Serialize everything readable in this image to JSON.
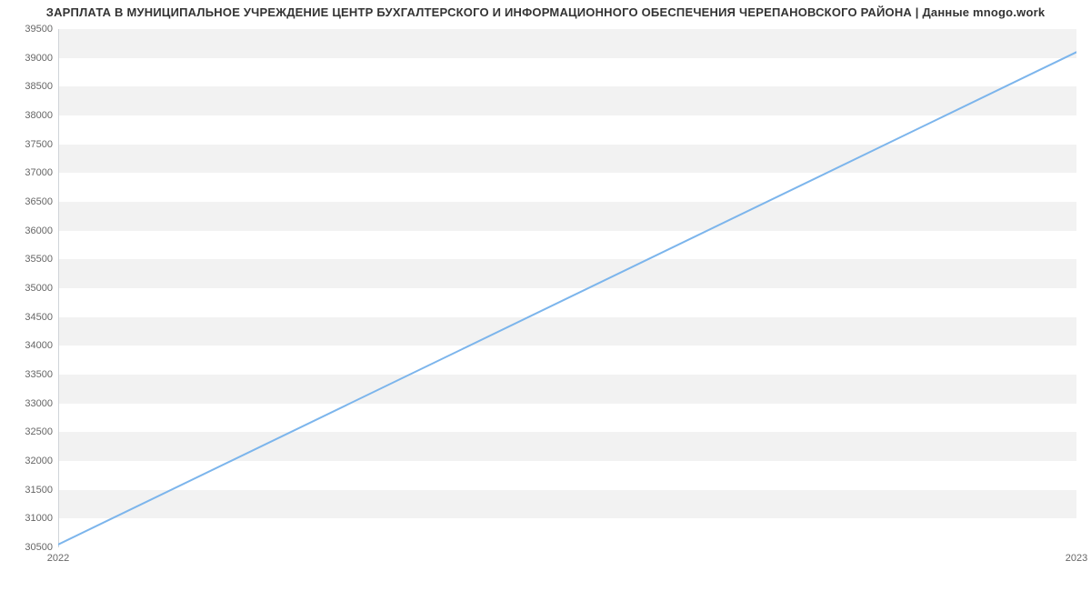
{
  "chart_data": {
    "type": "line",
    "title": "ЗАРПЛАТА В МУНИЦИПАЛЬНОЕ УЧРЕЖДЕНИЕ ЦЕНТР БУХГАЛТЕРСКОГО И ИНФОРМАЦИОННОГО ОБЕСПЕЧЕНИЯ ЧЕРЕПАНОВСКОГО РАЙОНА | Данные mnogo.work",
    "xlabel": "",
    "ylabel": "",
    "categories": [
      "2022",
      "2023"
    ],
    "values": [
      30550,
      39100
    ],
    "ylim": [
      30500,
      39500
    ],
    "yticks": [
      30500,
      31000,
      31500,
      32000,
      32500,
      33000,
      33500,
      34000,
      34500,
      35000,
      35500,
      36000,
      36500,
      37000,
      37500,
      38000,
      38500,
      39000,
      39500
    ],
    "line_color": "#7cb5ec"
  }
}
